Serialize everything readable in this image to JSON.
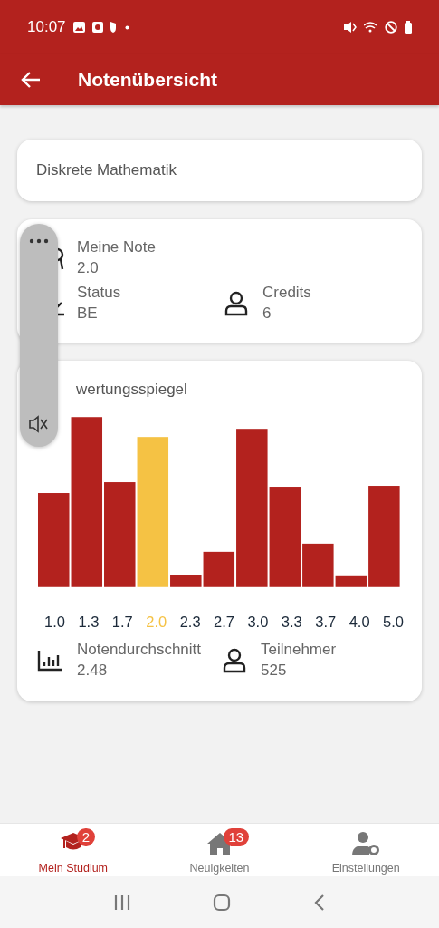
{
  "status_bar": {
    "time": "10:07"
  },
  "app_bar": {
    "title": "Notenübersicht"
  },
  "course": {
    "name": "Diskrete Mathematik"
  },
  "summary": [
    {
      "kind": "grade",
      "label": "Meine Note",
      "value": "2.0"
    },
    {
      "kind": "status",
      "label": "Status",
      "value": "BE"
    },
    {
      "kind": "person",
      "label": "Credits",
      "value": "6"
    }
  ],
  "distribution": {
    "title": "wertungsspiegel",
    "grades": [
      {
        "label": "1.0",
        "selected": false
      },
      {
        "label": "1.3",
        "selected": false
      },
      {
        "label": "1.7",
        "selected": false
      },
      {
        "label": "2.0",
        "selected": true
      },
      {
        "label": "2.3",
        "selected": false
      },
      {
        "label": "2.7",
        "selected": false
      },
      {
        "label": "3.0",
        "selected": false
      },
      {
        "label": "3.3",
        "selected": false
      },
      {
        "label": "3.7",
        "selected": false
      },
      {
        "label": "4.0",
        "selected": false
      },
      {
        "label": "5.0",
        "selected": false
      }
    ],
    "stats": [
      {
        "kind": "chart",
        "label": "Notendurchschnitt",
        "value": "2.48"
      },
      {
        "kind": "person",
        "label": "Teilnehmer",
        "value": "525"
      }
    ]
  },
  "bottom_nav": [
    {
      "kind": "study",
      "label": "Mein Studium",
      "badge": "2",
      "selected": true
    },
    {
      "kind": "home",
      "label": "Neuigkeiten",
      "badge": "13",
      "selected": false
    },
    {
      "kind": "settings",
      "label": "Einstellungen",
      "selected": false
    }
  ]
}
